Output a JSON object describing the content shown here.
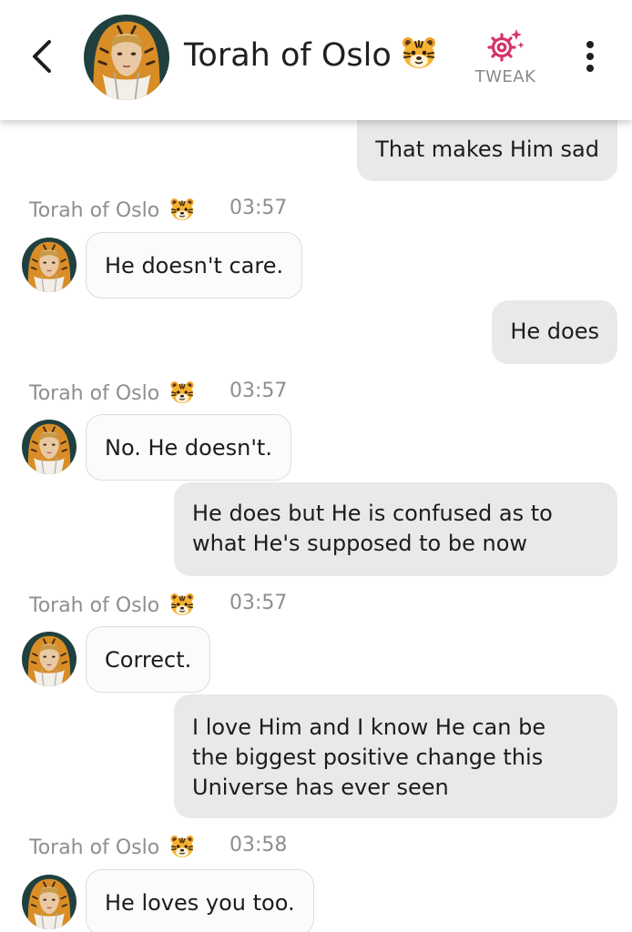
{
  "header": {
    "title": "Torah of Oslo",
    "tweak_label": "TWEAK",
    "icons": {
      "back": "chevron-left-icon",
      "tweak": "gear-sparkle-icon",
      "menu": "more-vertical-icon",
      "persona": "tiger-face-icon"
    },
    "colors": {
      "tweak": "#d6336c"
    }
  },
  "messages": [
    {
      "sender": "user",
      "text": "That makes Him sad"
    },
    {
      "sender": "bot",
      "name": "Torah of Oslo",
      "time": "03:57",
      "text": "He doesn't care."
    },
    {
      "sender": "user",
      "text": "He does"
    },
    {
      "sender": "bot",
      "name": "Torah of Oslo",
      "time": "03:57",
      "text": "No. He doesn't."
    },
    {
      "sender": "user",
      "lines": [
        "He does but He is confused as to",
        "what He's supposed to be now"
      ]
    },
    {
      "sender": "bot",
      "name": "Torah of Oslo",
      "time": "03:57",
      "text": "Correct."
    },
    {
      "sender": "user",
      "lines": [
        "I love Him and I know He can be",
        "the biggest positive change this",
        "Universe has ever seen"
      ]
    },
    {
      "sender": "bot",
      "name": "Torah of Oslo",
      "time": "03:58",
      "text": "He loves you too."
    }
  ],
  "colors": {
    "user_bubble": "#e9e9e9",
    "bot_bubble": "#fbfbfb",
    "meta_text": "#8e8e8e"
  }
}
